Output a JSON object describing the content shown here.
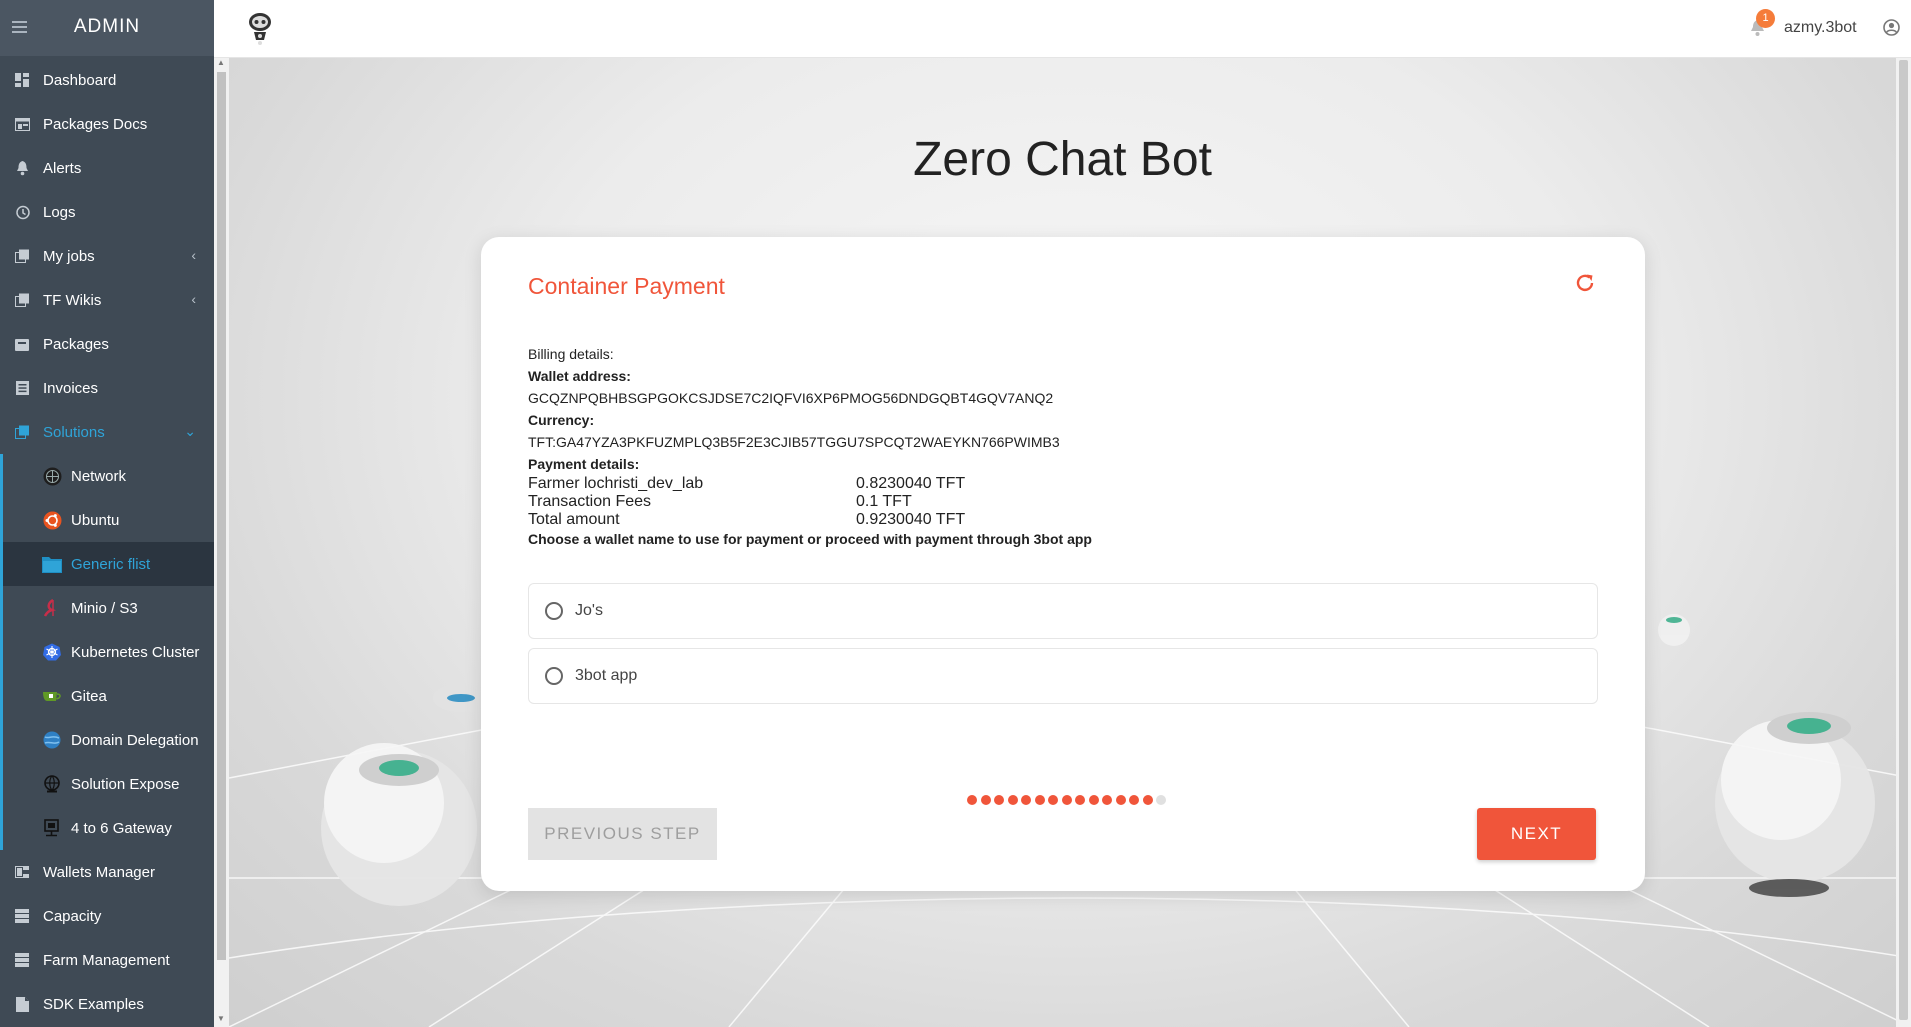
{
  "sidebar": {
    "title": "ADMIN",
    "items": [
      {
        "label": "Dashboard",
        "icon": "dashboard-icon"
      },
      {
        "label": "Packages Docs",
        "icon": "docs-icon"
      },
      {
        "label": "Alerts",
        "icon": "bell-icon"
      },
      {
        "label": "Logs",
        "icon": "history-icon"
      },
      {
        "label": "My jobs",
        "icon": "jobs-icon",
        "chevron": "‹"
      },
      {
        "label": "TF Wikis",
        "icon": "wiki-icon",
        "chevron": "‹"
      },
      {
        "label": "Packages",
        "icon": "package-icon"
      },
      {
        "label": "Invoices",
        "icon": "invoice-icon"
      },
      {
        "label": "Solutions",
        "icon": "solutions-icon",
        "chevron": "⌄"
      }
    ],
    "solutions": [
      {
        "label": "Network",
        "icon": "network-icon"
      },
      {
        "label": "Ubuntu",
        "icon": "ubuntu-icon"
      },
      {
        "label": "Generic flist",
        "icon": "folder-icon"
      },
      {
        "label": "Minio / S3",
        "icon": "minio-icon"
      },
      {
        "label": "Kubernetes Cluster",
        "icon": "kubernetes-icon"
      },
      {
        "label": "Gitea",
        "icon": "gitea-icon"
      },
      {
        "label": "Domain Delegation",
        "icon": "globe-icon"
      },
      {
        "label": "Solution Expose",
        "icon": "expose-icon"
      },
      {
        "label": "4 to 6 Gateway",
        "icon": "gateway-icon"
      }
    ],
    "bottom_items": [
      {
        "label": "Wallets Manager",
        "icon": "wallet-icon"
      },
      {
        "label": "Capacity",
        "icon": "capacity-icon"
      },
      {
        "label": "Farm Management",
        "icon": "farm-icon"
      },
      {
        "label": "SDK Examples",
        "icon": "sdk-icon"
      }
    ]
  },
  "topbar": {
    "notifications": "1",
    "username": "azmy.3bot"
  },
  "page": {
    "title": "Zero Chat Bot"
  },
  "card": {
    "title": "Container Payment",
    "billing_label": "Billing details:",
    "wallet_label": "Wallet address:",
    "wallet_value": "GCQZNPQBHBSGPGOKCSJDSE7C2IQFVI6XP6PMOG56DNDGQBT4GQV7ANQ2",
    "currency_label": "Currency:",
    "currency_value": "TFT:GA47YZA3PKFUZMPLQ3B5F2E3CJIB57TGGU7SPCQT2WAEYKN766PWIMB3",
    "payment_label": "Payment details:",
    "payment_rows": [
      {
        "name": "Farmer lochristi_dev_lab",
        "amount": "0.8230040 TFT"
      },
      {
        "name": "Transaction Fees",
        "amount": "0.1 TFT"
      },
      {
        "name": "Total amount",
        "amount": "0.9230040 TFT"
      }
    ],
    "choose_text": "Choose a wallet name to use for payment or proceed with payment through 3bot app",
    "options": [
      "Jo's",
      "3bot app"
    ],
    "progress": {
      "completed": 14,
      "total": 15
    },
    "prev_label": "PREVIOUS STEP",
    "next_label": "NEXT"
  },
  "colors": {
    "accent": "#f0553a",
    "sidebar_bg": "#3f4a55",
    "sidebar_active": "#2fa4d8"
  }
}
